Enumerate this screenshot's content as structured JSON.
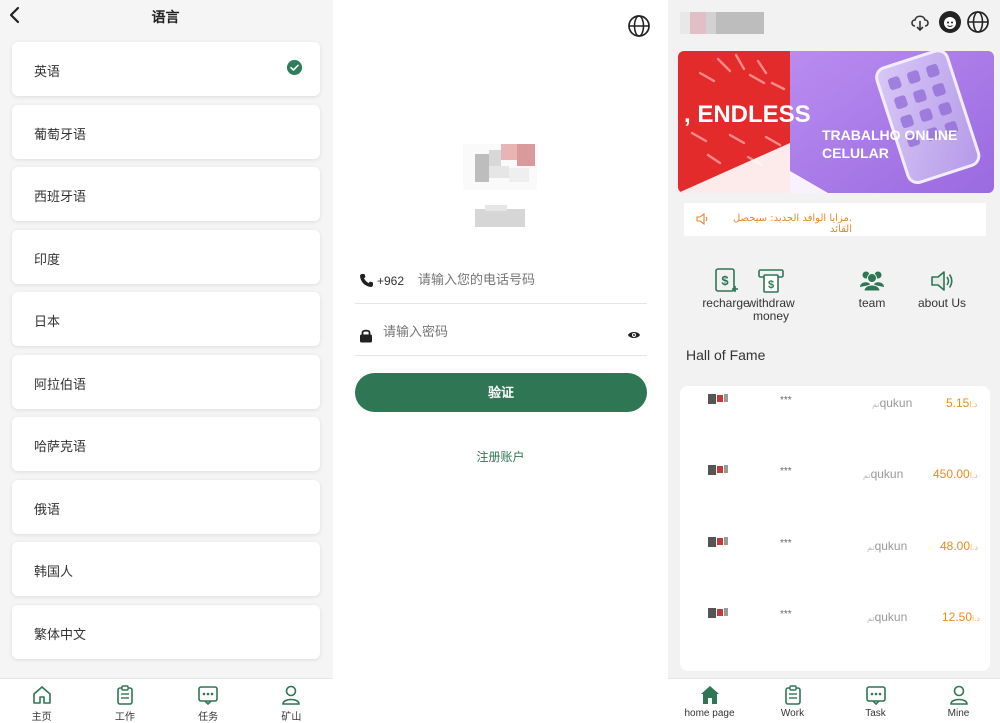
{
  "language_panel": {
    "title": "语言",
    "languages": [
      {
        "label": "英语",
        "selected": true
      },
      {
        "label": "葡萄牙语",
        "selected": false
      },
      {
        "label": "西班牙语",
        "selected": false
      },
      {
        "label": "印度",
        "selected": false
      },
      {
        "label": "日本",
        "selected": false
      },
      {
        "label": "阿拉伯语",
        "selected": false
      },
      {
        "label": "哈萨克语",
        "selected": false
      },
      {
        "label": "俄语",
        "selected": false
      },
      {
        "label": "韩国人",
        "selected": false
      },
      {
        "label": "繁体中文",
        "selected": false
      }
    ],
    "tabs": [
      {
        "label": "主页",
        "icon": "home-outline-icon"
      },
      {
        "label": "工作",
        "icon": "clipboard-icon"
      },
      {
        "label": "任务",
        "icon": "chat-dots-icon"
      },
      {
        "label": "矿山",
        "icon": "person-icon"
      }
    ]
  },
  "login_panel": {
    "phone_prefix": "+962",
    "phone_placeholder": "请输入您的电话号码",
    "password_placeholder": "请输入密码",
    "verify_button": "验证",
    "register_link": "注册账户"
  },
  "home_panel": {
    "banner": {
      "left_text": ", ENDLESS",
      "right_line1": "TRABALHO ONLINE",
      "right_line2": "CELULAR"
    },
    "notice": ".مزايا الوافد الجديد: سيحصل القائد",
    "menu": [
      {
        "label": "recharge",
        "icon": "recharge-icon"
      },
      {
        "label": "withdraw money",
        "icon": "withdraw-icon"
      },
      {
        "label": "team",
        "icon": "team-icon"
      },
      {
        "label": "about Us",
        "icon": "speaker-icon"
      }
    ],
    "hall_of_fame_title": "Hall of Fame",
    "hall_of_fame": [
      {
        "stars": "***",
        "name": "qukun",
        "name_suffix": "تم",
        "currency": "د.ا",
        "amount": "5.15"
      },
      {
        "stars": "***",
        "name": "qukun",
        "name_suffix": "تم",
        "currency": "د.ا",
        "amount": "450.00"
      },
      {
        "stars": "***",
        "name": "qukun",
        "name_suffix": "تم",
        "currency": "د.ا",
        "amount": "48.00"
      },
      {
        "stars": "***",
        "name": "qukun",
        "name_suffix": "تم",
        "currency": "د.ا",
        "amount": "12.50"
      }
    ],
    "tabs": [
      {
        "label": "home page",
        "icon": "home-filled-icon"
      },
      {
        "label": "Work",
        "icon": "clipboard-icon"
      },
      {
        "label": "Task",
        "icon": "chat-dots-icon"
      },
      {
        "label": "Mine",
        "icon": "person-icon"
      }
    ]
  },
  "colors": {
    "primary_green": "#2e7654",
    "amount_orange": "#f08a1c",
    "notice_orange": "#e08a2e"
  }
}
